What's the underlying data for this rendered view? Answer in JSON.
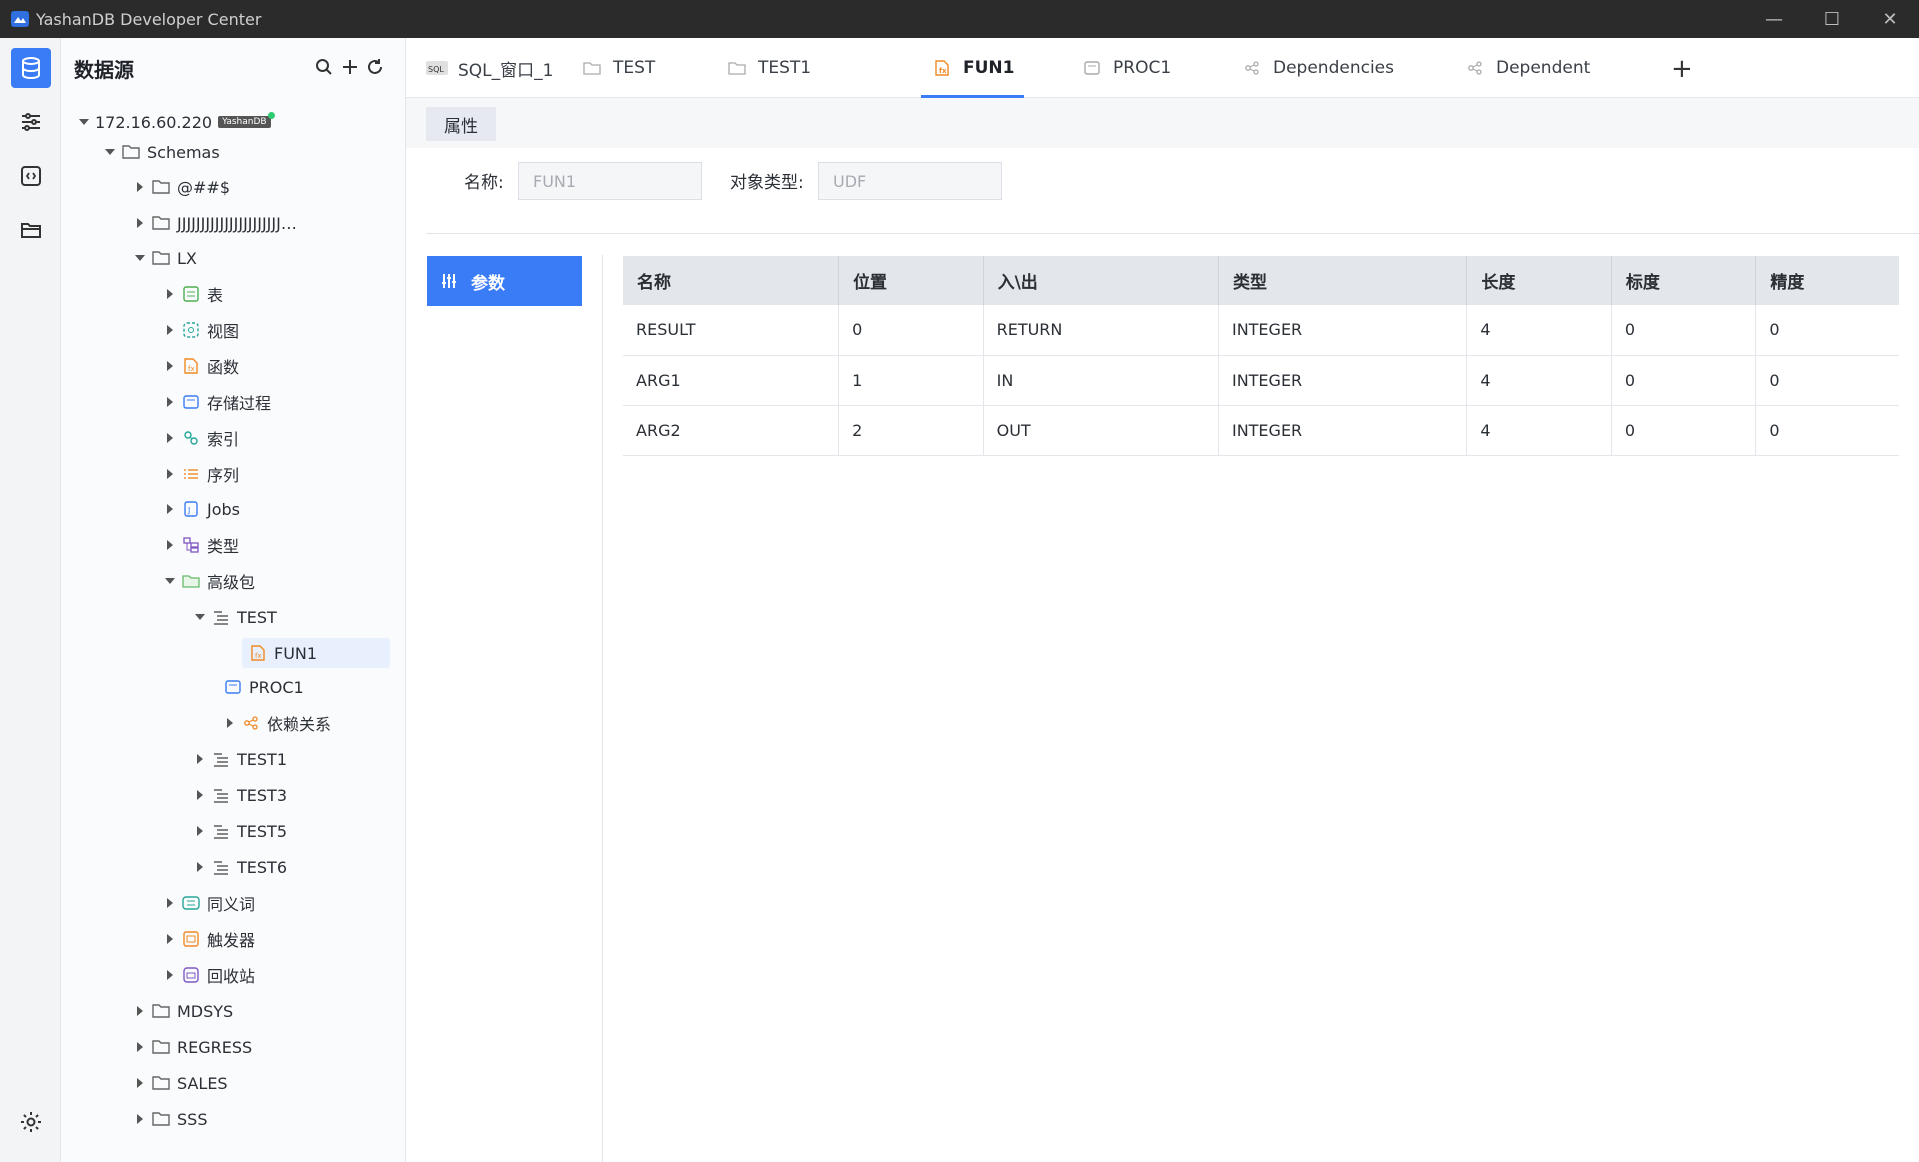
{
  "app": {
    "title": "YashanDB Developer Center"
  },
  "window_controls": {
    "minimize": "—",
    "maximize": "☐",
    "close": "✕"
  },
  "colors": {
    "accent": "#3a7cf5",
    "titlebar": "#2b2b2b"
  },
  "tree": {
    "title": "数据源",
    "connection": {
      "label": "172.16.60.220",
      "badge": "YashanDB"
    },
    "rows": [
      {
        "label": "Schemas",
        "depth": 1,
        "state": "open",
        "icon": "folder-icon"
      },
      {
        "label": "@##$",
        "depth": 2,
        "state": "closed",
        "icon": "folder-icon"
      },
      {
        "label": "JJJJJJJJJJJJJJJJJJJJJJ…",
        "depth": 2,
        "state": "closed",
        "icon": "folder-icon"
      },
      {
        "label": "LX",
        "depth": 2,
        "state": "open",
        "icon": "folder-icon"
      },
      {
        "label": "表",
        "depth": 3,
        "state": "closed",
        "icon": "table-icon"
      },
      {
        "label": "视图",
        "depth": 3,
        "state": "closed",
        "icon": "view-icon"
      },
      {
        "label": "函数",
        "depth": 3,
        "state": "closed",
        "icon": "function-icon"
      },
      {
        "label": "存储过程",
        "depth": 3,
        "state": "closed",
        "icon": "procedure-icon"
      },
      {
        "label": "索引",
        "depth": 3,
        "state": "closed",
        "icon": "index-icon"
      },
      {
        "label": "序列",
        "depth": 3,
        "state": "closed",
        "icon": "sequence-icon"
      },
      {
        "label": "Jobs",
        "depth": 3,
        "state": "closed",
        "icon": "job-icon"
      },
      {
        "label": "类型",
        "depth": 3,
        "state": "closed",
        "icon": "type-icon"
      },
      {
        "label": "高级包",
        "depth": 3,
        "state": "open",
        "icon": "package-icon"
      },
      {
        "label": "TEST",
        "depth": 4,
        "state": "open",
        "icon": "package-body-icon"
      },
      {
        "label": "FUN1",
        "depth": 5,
        "state": "leaf",
        "icon": "function-icon",
        "selected": true
      },
      {
        "label": "PROC1",
        "depth": 5,
        "state": "leaf",
        "icon": "procedure-icon"
      },
      {
        "label": "依赖关系",
        "depth": 5,
        "state": "closed",
        "icon": "dependency-icon"
      },
      {
        "label": "TEST1",
        "depth": 4,
        "state": "closed",
        "icon": "package-body-icon"
      },
      {
        "label": "TEST3",
        "depth": 4,
        "state": "closed",
        "icon": "package-body-icon"
      },
      {
        "label": "TEST5",
        "depth": 4,
        "state": "closed",
        "icon": "package-body-icon"
      },
      {
        "label": "TEST6",
        "depth": 4,
        "state": "closed",
        "icon": "package-body-icon"
      },
      {
        "label": "同义词",
        "depth": 3,
        "state": "closed",
        "icon": "synonym-icon"
      },
      {
        "label": "触发器",
        "depth": 3,
        "state": "closed",
        "icon": "trigger-icon"
      },
      {
        "label": "回收站",
        "depth": 3,
        "state": "closed",
        "icon": "recycle-bin-icon"
      },
      {
        "label": "MDSYS",
        "depth": 2,
        "state": "closed",
        "icon": "folder-icon"
      },
      {
        "label": "REGRESS",
        "depth": 2,
        "state": "closed",
        "icon": "folder-icon"
      },
      {
        "label": "SALES",
        "depth": 2,
        "state": "closed",
        "icon": "folder-icon"
      },
      {
        "label": "SSS",
        "depth": 2,
        "state": "closed",
        "icon": "folder-icon"
      }
    ]
  },
  "tabs": [
    {
      "label": "SQL_窗口_1",
      "icon": "sql-icon"
    },
    {
      "label": "TEST",
      "icon": "package-icon"
    },
    {
      "label": "TEST1",
      "icon": "package-icon"
    },
    {
      "label": "FUN1",
      "icon": "function-icon",
      "active": true
    },
    {
      "label": "PROC1",
      "icon": "procedure-icon"
    },
    {
      "label": "Dependencies",
      "icon": "dependency-icon"
    },
    {
      "label": "Dependent",
      "icon": "dependency-icon"
    }
  ],
  "tab_add": "+",
  "subtab": "属性",
  "props": {
    "name_label": "名称:",
    "name_value": "FUN1",
    "type_label": "对象类型:",
    "type_value": "UDF"
  },
  "side": {
    "params_button": "参数"
  },
  "table": {
    "headers": [
      "名称",
      "位置",
      "入\\出",
      "类型",
      "长度",
      "标度",
      "精度"
    ],
    "rows": [
      [
        "RESULT",
        "0",
        "RETURN",
        "INTEGER",
        "4",
        "0",
        "0"
      ],
      [
        "ARG1",
        "1",
        "IN",
        "INTEGER",
        "4",
        "0",
        "0"
      ],
      [
        "ARG2",
        "2",
        "OUT",
        "INTEGER",
        "4",
        "0",
        "0"
      ]
    ]
  }
}
